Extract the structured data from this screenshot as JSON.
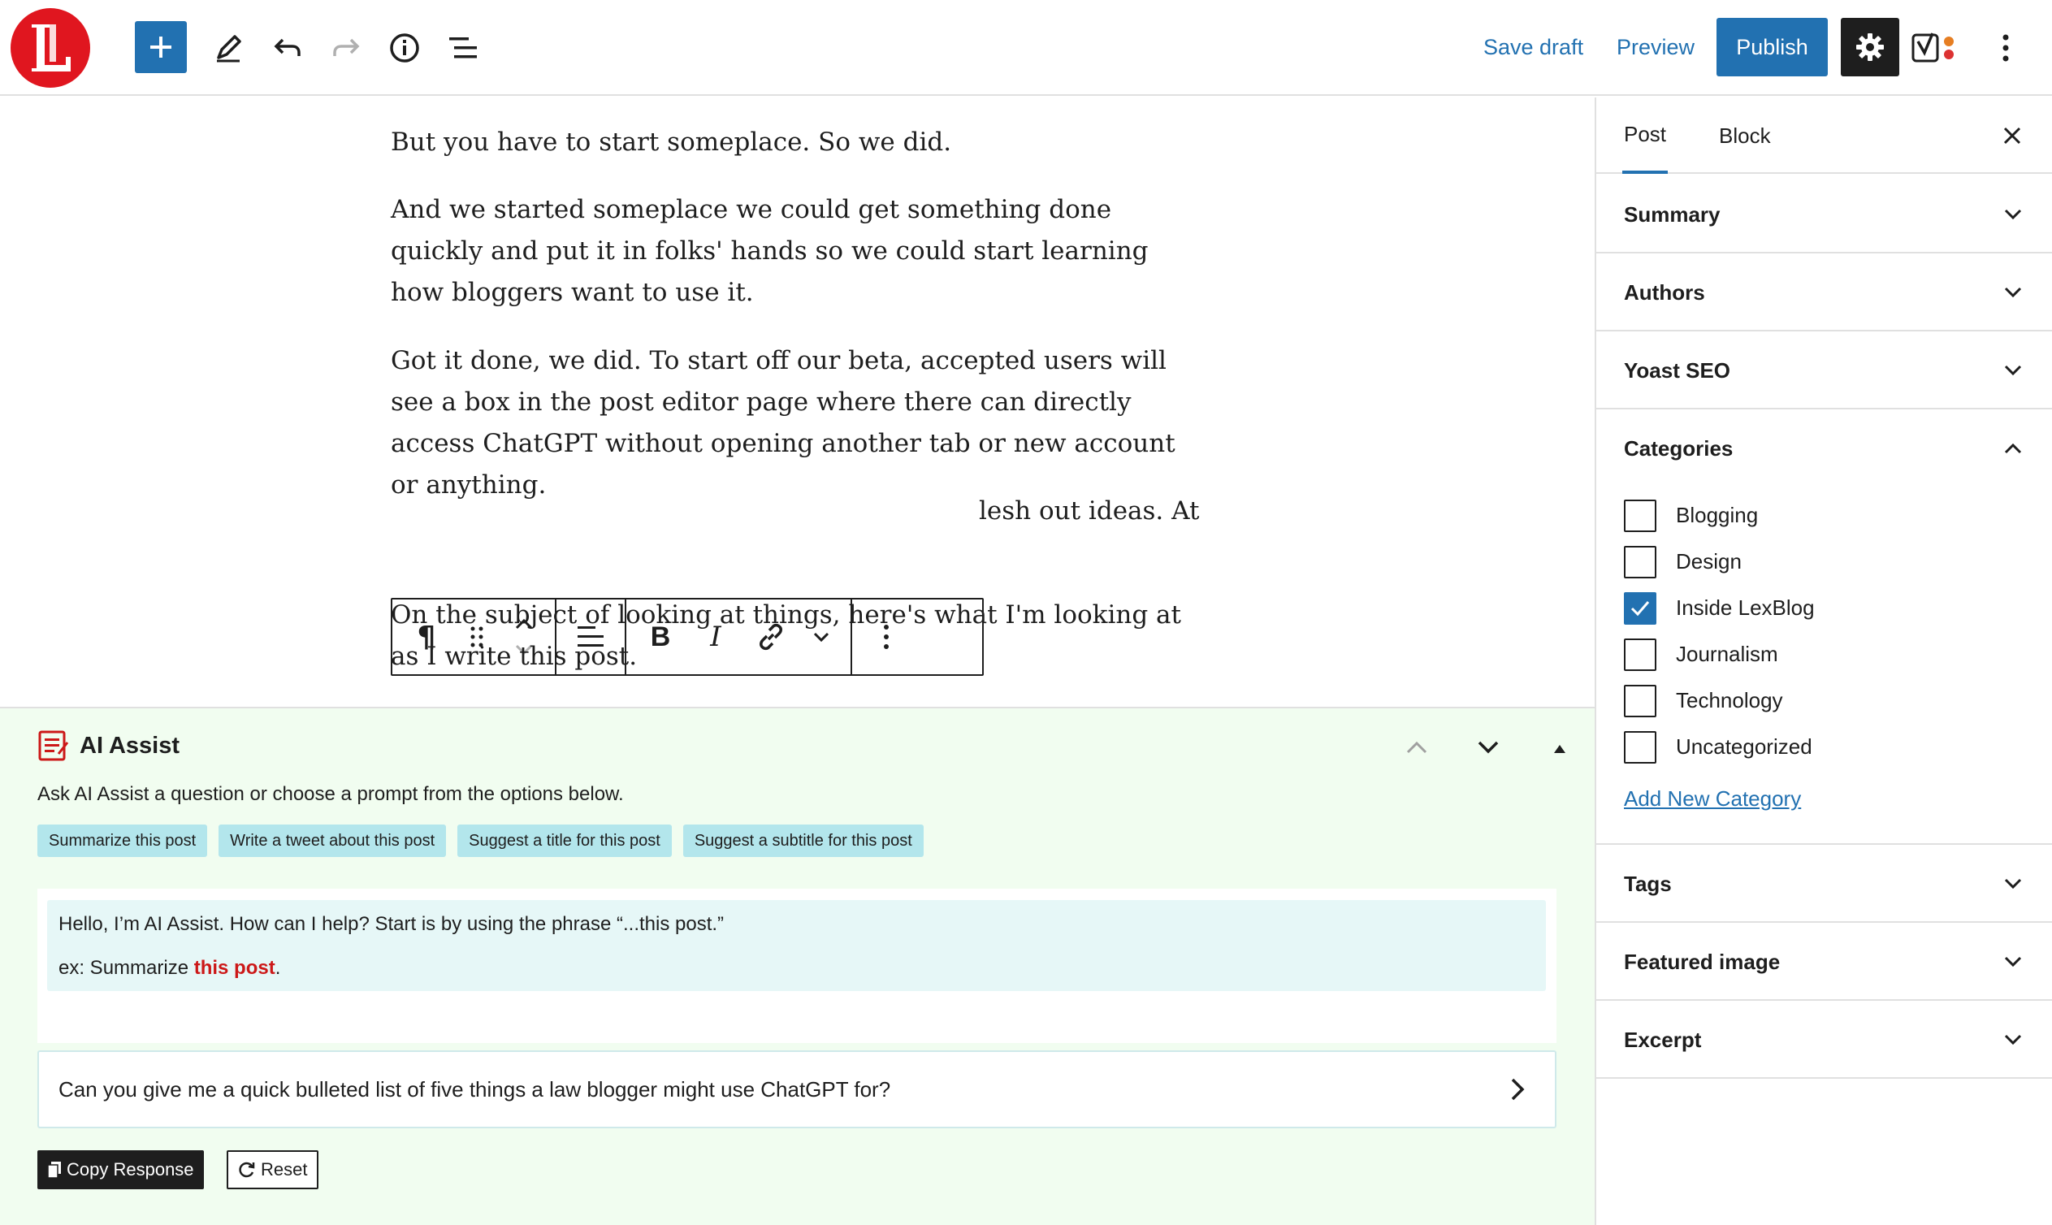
{
  "toolbar": {
    "save_draft": "Save draft",
    "preview": "Preview",
    "publish": "Publish"
  },
  "editor": {
    "paragraphs": [
      "But you have to start someplace. So we did.",
      "And we started someplace we could get something done quickly and put it in folks' hands so we could start learning how bloggers want to use it.",
      "Got it done, we did. To start off our beta, accepted users will see a box in the post editor page where there can directly access ChatGPT without opening another tab or new account or anything.",
      "lesh out ideas. At",
      "On the subject of looking at things, here's what I'm looking at as I write this post."
    ]
  },
  "ai_assist": {
    "title": "AI Assist",
    "subtitle": "Ask AI Assist a question or choose a prompt from the options below.",
    "chips": [
      "Summarize this post",
      "Write a tweet about this post",
      "Suggest a title for this post",
      "Suggest a subtitle for this post"
    ],
    "message_line1": "Hello, I’m AI Assist. How can I help? Start is by using the phrase “...this post.”",
    "message_prefix": "ex: Summarize ",
    "message_em": "this post",
    "message_suffix": ".",
    "prompt_value": "Can you give me a quick bulleted list of five things a law blogger might use ChatGPT for?",
    "copy_label": "Copy Response",
    "reset_label": "Reset"
  },
  "sidebar": {
    "tabs": [
      "Post",
      "Block"
    ],
    "panels_top": [
      "Summary",
      "Authors",
      "Yoast SEO"
    ],
    "categories_title": "Categories",
    "categories": [
      {
        "label": "Blogging",
        "checked": false
      },
      {
        "label": "Design",
        "checked": false
      },
      {
        "label": "Inside LexBlog",
        "checked": true
      },
      {
        "label": "Journalism",
        "checked": false
      },
      {
        "label": "Technology",
        "checked": false
      },
      {
        "label": "Uncategorized",
        "checked": false
      }
    ],
    "add_category": "Add New Category",
    "panels_bottom": [
      "Tags",
      "Featured image",
      "Excerpt"
    ]
  },
  "colors": {
    "accent": "#2271b1",
    "logo": "#e0161f",
    "panel_bg": "#f1fdf0",
    "chip_bg": "#b3e6ec",
    "highlight_text": "#cc1818"
  }
}
